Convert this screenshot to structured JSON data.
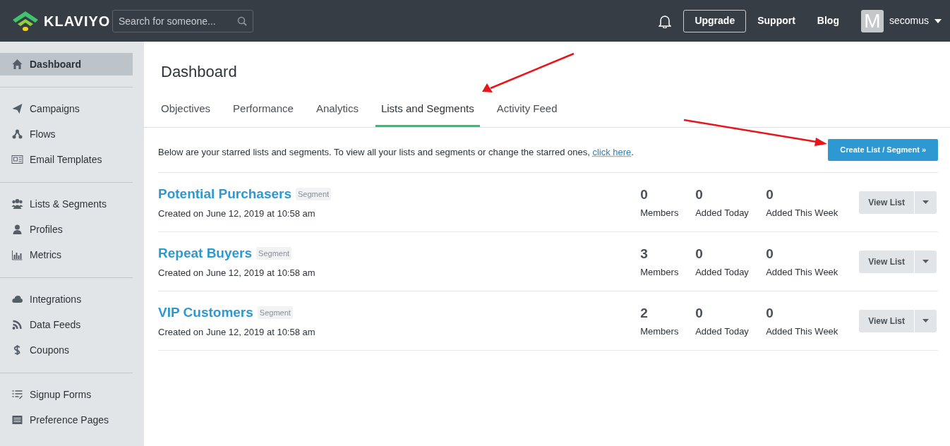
{
  "header": {
    "logo": "KLAVIYO",
    "search": {
      "placeholder": "Search for someone..."
    },
    "upgrade": "Upgrade",
    "links": [
      "Support",
      "Blog"
    ],
    "avatar": "M",
    "user": "secomus"
  },
  "sidebar": {
    "groups": [
      [
        {
          "label": "Dashboard",
          "selected": true
        }
      ],
      [
        {
          "label": "Campaigns",
          "selected": false
        },
        {
          "label": "Flows",
          "selected": false
        },
        {
          "label": "Email Templates",
          "selected": false
        }
      ],
      [
        {
          "label": "Lists & Segments",
          "selected": false
        },
        {
          "label": "Profiles",
          "selected": false
        },
        {
          "label": "Metrics",
          "selected": false
        }
      ],
      [
        {
          "label": "Integrations",
          "selected": false
        },
        {
          "label": "Data Feeds",
          "selected": false
        },
        {
          "label": "Coupons",
          "selected": false
        }
      ],
      [
        {
          "label": "Signup Forms",
          "selected": false
        },
        {
          "label": "Preference Pages",
          "selected": false
        }
      ]
    ]
  },
  "page_title": "Dashboard",
  "tabs": [
    {
      "label": "Objectives",
      "selected": false
    },
    {
      "label": "Performance",
      "selected": false
    },
    {
      "label": "Analytics",
      "selected": false
    },
    {
      "label": "Lists and Segments",
      "selected": true
    },
    {
      "label": "Activity Feed",
      "selected": false
    }
  ],
  "intro": {
    "text": "Below are your starred lists and segments. To view all your lists and segments or change the starred ones,",
    "link": "click here",
    "end": "."
  },
  "create_button": "Create List / Segment »",
  "lists": [
    {
      "name": "Potential Purchasers",
      "tag": "Segment",
      "created": "Created on June 12, 2019 at 10:58 am",
      "stats": [
        {
          "value": "0",
          "label": "Members"
        },
        {
          "value": "0",
          "label": "Added Today"
        },
        {
          "value": "0",
          "label": "Added This Week"
        }
      ],
      "button": "View List"
    },
    {
      "name": "Repeat Buyers",
      "tag": "Segment",
      "created": "Created on June 12, 2019 at 10:58 am",
      "stats": [
        {
          "value": "3",
          "label": "Members"
        },
        {
          "value": "0",
          "label": "Added Today"
        },
        {
          "value": "0",
          "label": "Added This Week"
        }
      ],
      "button": "View List"
    },
    {
      "name": "VIP Customers",
      "tag": "Segment",
      "created": "Created on June 12, 2019 at 10:58 am",
      "stats": [
        {
          "value": "2",
          "label": "Members"
        },
        {
          "value": "0",
          "label": "Added Today"
        },
        {
          "value": "0",
          "label": "Added This Week"
        }
      ],
      "button": "View List"
    }
  ]
}
